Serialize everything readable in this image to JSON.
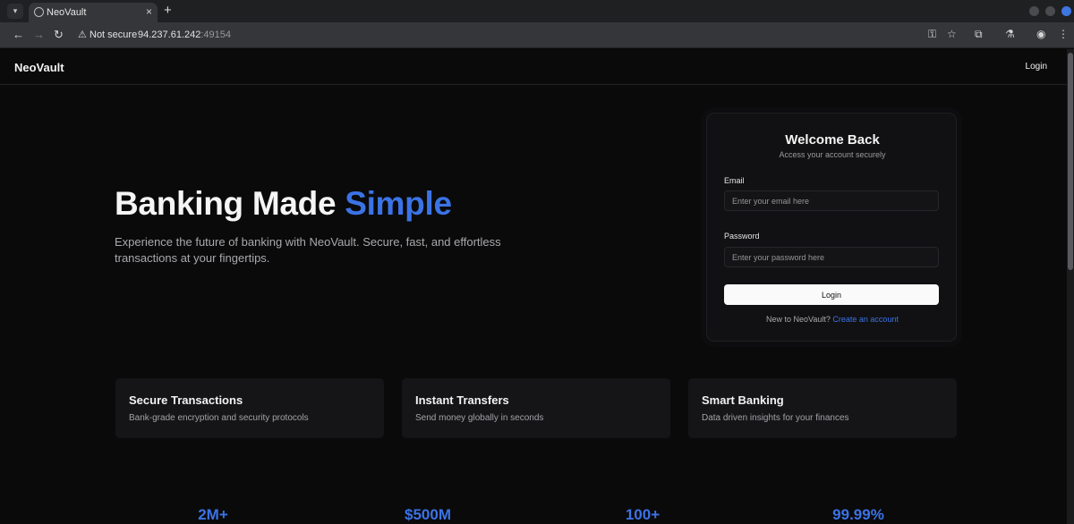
{
  "browser": {
    "tab_title": "NeoVault",
    "tab_close": "×",
    "new_tab": "+",
    "security_label": "Not secure",
    "url_host": "94.237.61.242",
    "url_port": ":49154"
  },
  "site": {
    "brand": "NeoVault",
    "header_login": "Login"
  },
  "hero": {
    "title_main": "Banking Made ",
    "title_accent": "Simple",
    "subtitle": "Experience the future of banking with NeoVault. Secure, fast, and effortless transactions at your fingertips."
  },
  "login_card": {
    "title": "Welcome Back",
    "subtitle": "Access your account securely",
    "email_label": "Email",
    "email_placeholder": "Enter your email here",
    "password_label": "Password",
    "password_placeholder": "Enter your password here",
    "submit": "Login",
    "footer_text": "New to NeoVault? ",
    "footer_link": "Create an account"
  },
  "features": [
    {
      "title": "Secure Transactions",
      "desc": "Bank-grade encryption and security protocols"
    },
    {
      "title": "Instant Transfers",
      "desc": "Send money globally in seconds"
    },
    {
      "title": "Smart Banking",
      "desc": "Data driven insights for your finances"
    }
  ],
  "stats": [
    "2M+",
    "$500M",
    "100+",
    "99.99%"
  ],
  "colors": {
    "accent": "#3b73e6",
    "background": "#0a0a0b",
    "card": "#111113"
  }
}
